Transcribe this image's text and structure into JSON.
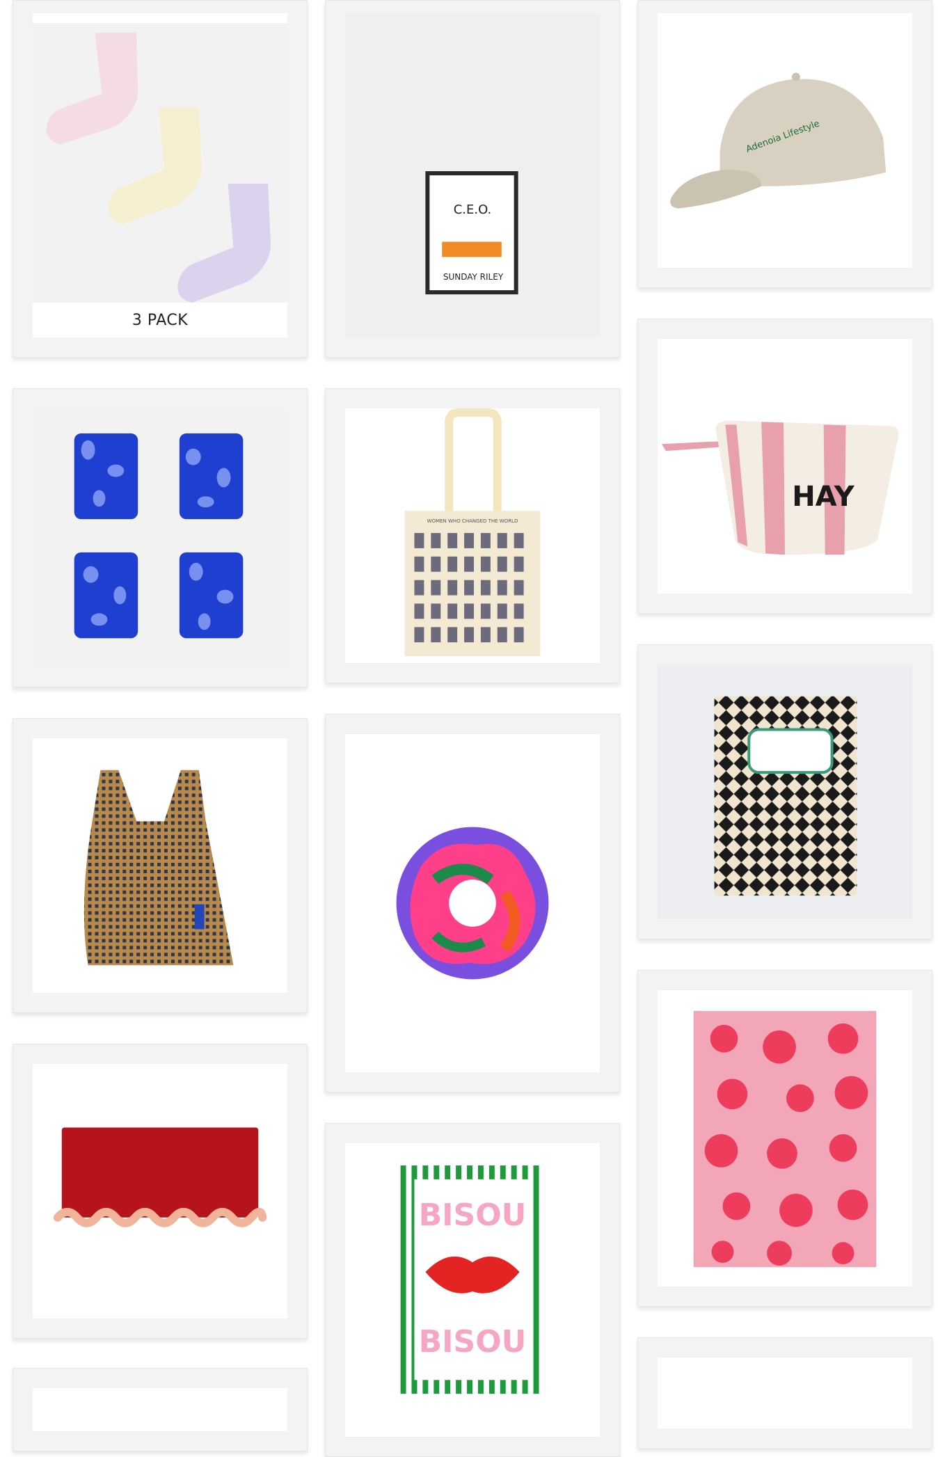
{
  "products": [
    {
      "id": "socks",
      "caption": "3 PACK"
    },
    {
      "id": "ceo",
      "brand_top": "C.E.O.",
      "brand_bottom": "SUNDAY RILEY"
    },
    {
      "id": "cap",
      "embroidery": "Adenoia Lifestyle"
    },
    {
      "id": "glasses"
    },
    {
      "id": "tote",
      "print_title": "WOMEN WHO CHANGED THE WORLD"
    },
    {
      "id": "pouch",
      "logo": "HAY"
    },
    {
      "id": "baggu"
    },
    {
      "id": "scrunchie"
    },
    {
      "id": "notebook"
    },
    {
      "id": "clutch"
    },
    {
      "id": "bisou",
      "line1": "BISOU",
      "line2": "BISOU"
    },
    {
      "id": "towel"
    },
    {
      "id": "partial-left"
    },
    {
      "id": "partial-right"
    }
  ],
  "colors": {
    "card_bg": "#f3f3f3",
    "glass_blue": "#1e3fd0",
    "hay_stripe": "#e8a0ad",
    "towel_pink": "#f3a6b8",
    "towel_red": "#ee3d5c",
    "clutch_red": "#b5141c",
    "bisou_green": "#1d9a3c",
    "bisou_pink": "#f6a6c3",
    "bisou_red": "#e42422"
  }
}
